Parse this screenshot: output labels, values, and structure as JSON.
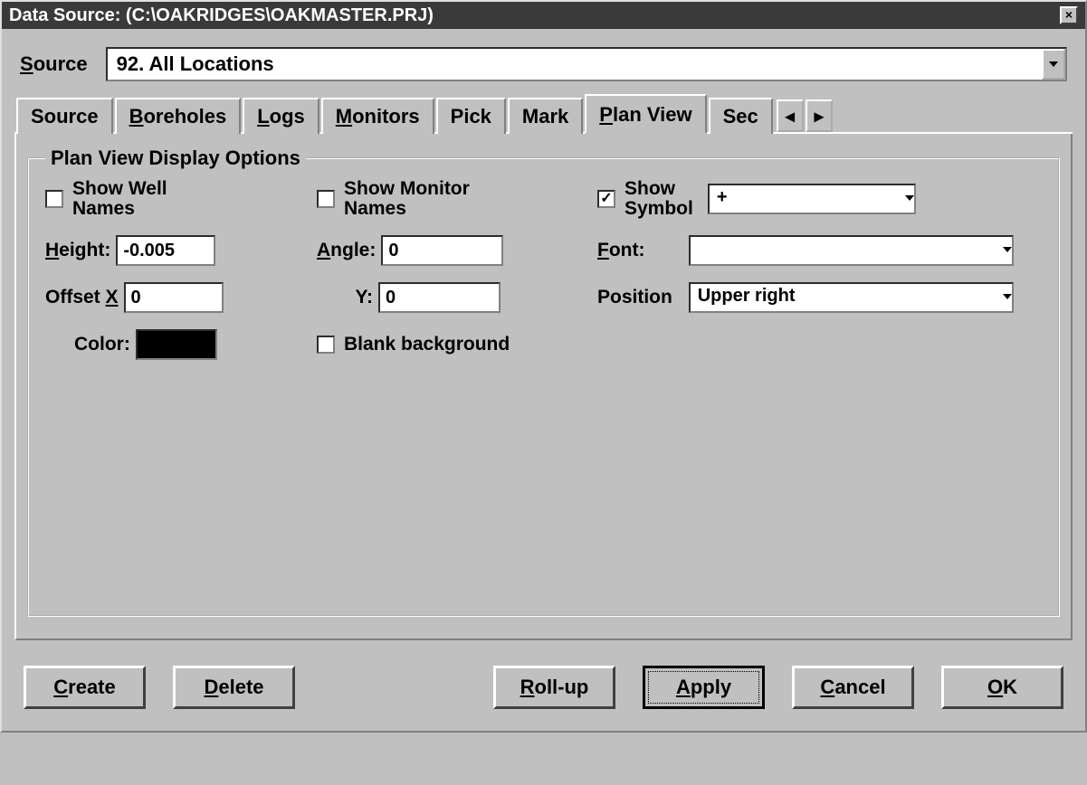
{
  "title": "Data Source: (C:\\OAKRIDGES\\OAKMASTER.PRJ)",
  "source_label": "Source",
  "source_value": "92. All Locations",
  "tabs": {
    "t0": "Source",
    "t1": "Boreholes",
    "t2": "Logs",
    "t3": "Monitors",
    "t4": "Pick",
    "t5": "Mark",
    "t6": "Plan View",
    "t7": "Sec"
  },
  "group": {
    "legend": "Plan View Display Options",
    "show_well_names": "Show Well Names",
    "show_monitor_names": "Show Monitor Names",
    "show_symbol": "Show Symbol",
    "symbol_value": "+",
    "height_label": "Height:",
    "height_value": "-0.005",
    "angle_label": "Angle:",
    "angle_value": "0",
    "font_label": "Font:",
    "font_value": "",
    "offsetx_label": "Offset X",
    "offsetx_value": "0",
    "y_label": "Y:",
    "y_value": "0",
    "position_label": "Position",
    "position_value": "Upper right",
    "color_label": "Color:",
    "color_value": "#000000",
    "blank_bg": "Blank background"
  },
  "buttons": {
    "create": "Create",
    "delete": "Delete",
    "rollup": "Roll-up",
    "apply": "Apply",
    "cancel": "Cancel",
    "ok": "OK"
  }
}
